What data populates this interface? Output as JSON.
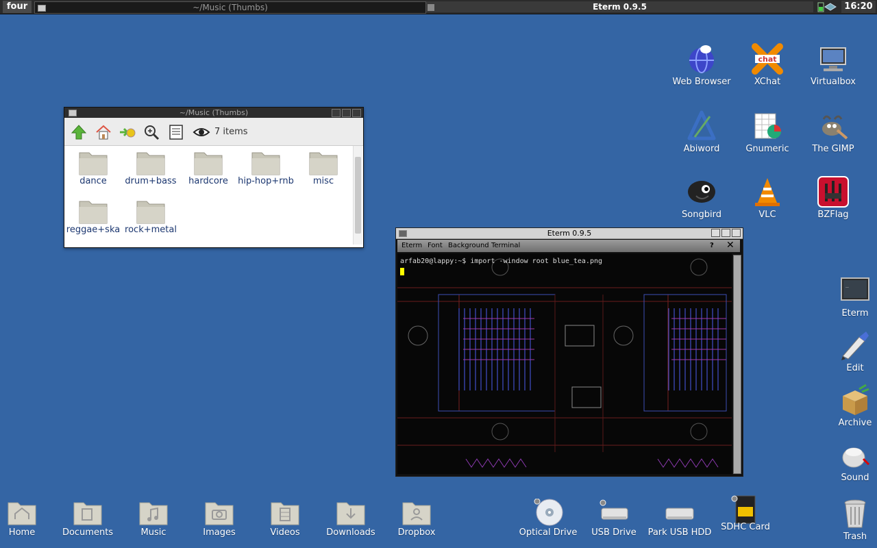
{
  "panel": {
    "workspace": "four",
    "tasks": [
      {
        "title": "~/Music (Thumbs)"
      },
      {
        "title": "Eterm 0.9.5"
      }
    ],
    "clock": "16:20"
  },
  "desktop_icons_right": [
    {
      "label": "Web Browser",
      "icon": "globe-icon"
    },
    {
      "label": "XChat",
      "icon": "xchat-icon"
    },
    {
      "label": "Virtualbox",
      "icon": "virtualbox-icon"
    },
    {
      "label": "Abiword",
      "icon": "abiword-icon"
    },
    {
      "label": "Gnumeric",
      "icon": "gnumeric-icon"
    },
    {
      "label": "The GIMP",
      "icon": "gimp-icon"
    },
    {
      "label": "Songbird",
      "icon": "songbird-icon"
    },
    {
      "label": "VLC",
      "icon": "vlc-icon"
    },
    {
      "label": "BZFlag",
      "icon": "bzflag-icon"
    }
  ],
  "desktop_icons_side": [
    {
      "label": "Eterm",
      "icon": "terminal-icon"
    },
    {
      "label": "Edit",
      "icon": "pen-icon"
    },
    {
      "label": "Archive",
      "icon": "box-icon"
    },
    {
      "label": "Sound",
      "icon": "speaker-icon"
    },
    {
      "label": "Trash",
      "icon": "trash-icon"
    }
  ],
  "desktop_icons_bottom": [
    {
      "label": "Home",
      "icon": "home-folder-icon"
    },
    {
      "label": "Documents",
      "icon": "documents-folder-icon"
    },
    {
      "label": "Music",
      "icon": "music-folder-icon"
    },
    {
      "label": "Images",
      "icon": "images-folder-icon"
    },
    {
      "label": "Videos",
      "icon": "videos-folder-icon"
    },
    {
      "label": "Downloads",
      "icon": "downloads-folder-icon"
    },
    {
      "label": "Dropbox",
      "icon": "dropbox-folder-icon"
    },
    {
      "label": "Optical Drive",
      "icon": "optical-drive-icon"
    },
    {
      "label": "USB Drive",
      "icon": "usb-drive-icon"
    },
    {
      "label": "Park USB HDD",
      "icon": "hdd-icon"
    },
    {
      "label": "SDHC Card",
      "icon": "sd-card-icon"
    }
  ],
  "file_manager": {
    "title": "~/Music (Thumbs)",
    "item_count": "7 items",
    "items": [
      "dance",
      "drum+bass",
      "hardcore",
      "hip-hop+rnb",
      "misc",
      "reggae+ska",
      "rock+metal"
    ]
  },
  "eterm": {
    "title": "Eterm 0.9.5",
    "menu": [
      "Eterm",
      "Font",
      "Background",
      "Terminal"
    ],
    "help": "?",
    "prompt": "arfab20@lappy:~$ import -window root blue_tea.png"
  },
  "colors": {
    "desktop": "#3465a4",
    "panel": "#2b2b2b",
    "folder": "#c8c6b8",
    "fm_text": "#1c3770"
  }
}
